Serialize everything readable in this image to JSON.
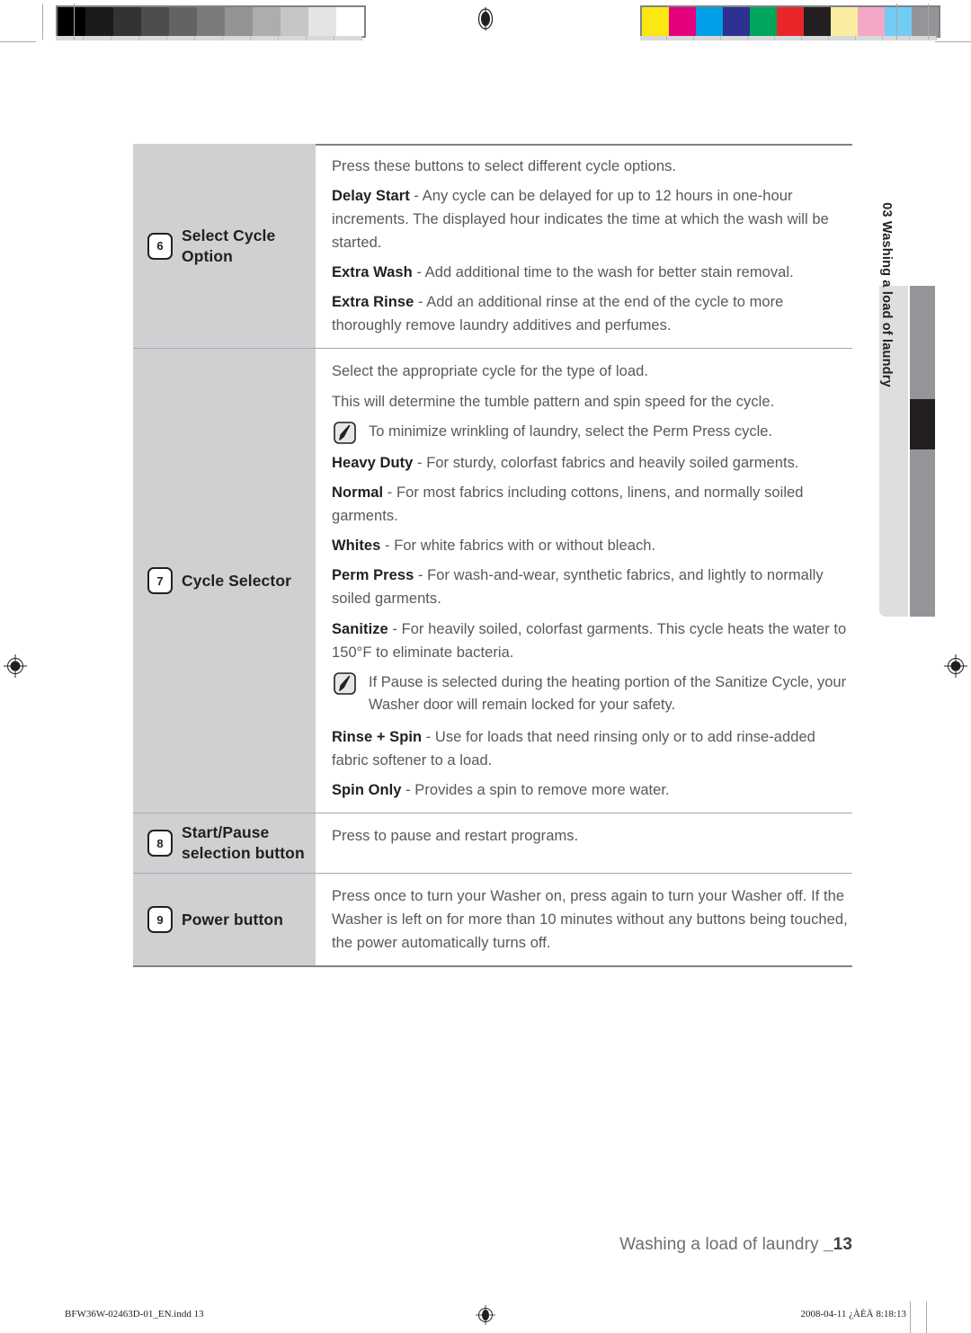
{
  "document": {
    "page_footer_label": "Washing a load of laundry",
    "page_number": "_13",
    "side_tab_label": "03 Washing a load of laundry"
  },
  "prepress": {
    "gray_swatches": [
      "#000000",
      "#1b1b1b",
      "#333333",
      "#4d4d4d",
      "#636363",
      "#7b7b7b",
      "#949494",
      "#adadad",
      "#c6c6c6",
      "#e4e4e4",
      "#ffffff"
    ],
    "color_swatches": [
      "#fbe712",
      "#e5007e",
      "#00a0e9",
      "#2e3192",
      "#00a65b",
      "#e8262a",
      "#231f20",
      "#faeda1",
      "#f4a7c6",
      "#72ccf4",
      "#939598"
    ],
    "registration_icon": "registration-target-icon"
  },
  "table": {
    "rows": [
      {
        "number": "6",
        "label": "Select Cycle Option",
        "paragraphs": [
          {
            "type": "text",
            "text": "Press these buttons to select different cycle options."
          },
          {
            "type": "text",
            "term": "Delay Start",
            "text": " - Any cycle can be delayed for up to 12 hours in one-hour increments. The displayed hour indicates the time at which the wash will be started."
          },
          {
            "type": "text",
            "term": "Extra Wash",
            "text": " - Add additional time to the wash for better stain removal."
          },
          {
            "type": "text",
            "term": "Extra Rinse",
            "text": " - Add an additional rinse at the end of the cycle to more thoroughly remove laundry additives and perfumes."
          }
        ]
      },
      {
        "number": "7",
        "label": "Cycle Selector",
        "paragraphs": [
          {
            "type": "text",
            "text": "Select the appropriate cycle for the type of load."
          },
          {
            "type": "text",
            "text": "This will determine the tumble pattern and spin speed for the cycle."
          },
          {
            "type": "note",
            "text": "To minimize wrinkling of laundry, select the Perm Press cycle."
          },
          {
            "type": "text",
            "term": "Heavy Duty",
            "text": " - For sturdy, colorfast fabrics and heavily soiled garments."
          },
          {
            "type": "text",
            "term": "Normal",
            "text": " - For most fabrics including cottons, linens, and normally soiled garments."
          },
          {
            "type": "text",
            "term": "Whites",
            "text": " - For white fabrics with or without bleach."
          },
          {
            "type": "text",
            "term": "Perm Press",
            "text": " - For wash-and-wear, synthetic fabrics, and lightly to normally soiled garments."
          },
          {
            "type": "text",
            "term": "Sanitize",
            "text": " - For heavily soiled, colorfast garments. This cycle heats the water to 150°F to eliminate bacteria."
          },
          {
            "type": "note",
            "text": "If Pause is selected during the heating portion of the Sanitize Cycle, your Washer door will remain locked for your safety."
          },
          {
            "type": "text",
            "term": "Rinse + Spin",
            "text": " - Use for loads that need rinsing only or to add rinse-added fabric softener to a load."
          },
          {
            "type": "text",
            "term": "Spin Only",
            "text": " - Provides a spin to remove more water."
          }
        ]
      },
      {
        "number": "8",
        "label": "Start/Pause selection button",
        "paragraphs": [
          {
            "type": "text",
            "text": "Press to pause and restart programs."
          }
        ]
      },
      {
        "number": "9",
        "label": "Power button",
        "paragraphs": [
          {
            "type": "text",
            "text": "Press once to turn your Washer on, press again to turn your Washer off. If the Washer is left on for more than 10 minutes without any buttons being touched, the power automatically turns off."
          }
        ]
      }
    ]
  },
  "imposition_footer": {
    "filename": "BFW36W-02463D-01_EN.indd   13",
    "timestamp": "2008-04-11   ¿ÀÈÄ 8:18:13",
    "center_icon": "registration-target-icon"
  },
  "colors": {
    "label_cell_bg": "#cfd0d2",
    "body_text": "#58595b",
    "heading_text": "#231f20",
    "rule": "#a7a9ac",
    "tab_gray": "#939598",
    "tab_light": "#dcdee0"
  }
}
